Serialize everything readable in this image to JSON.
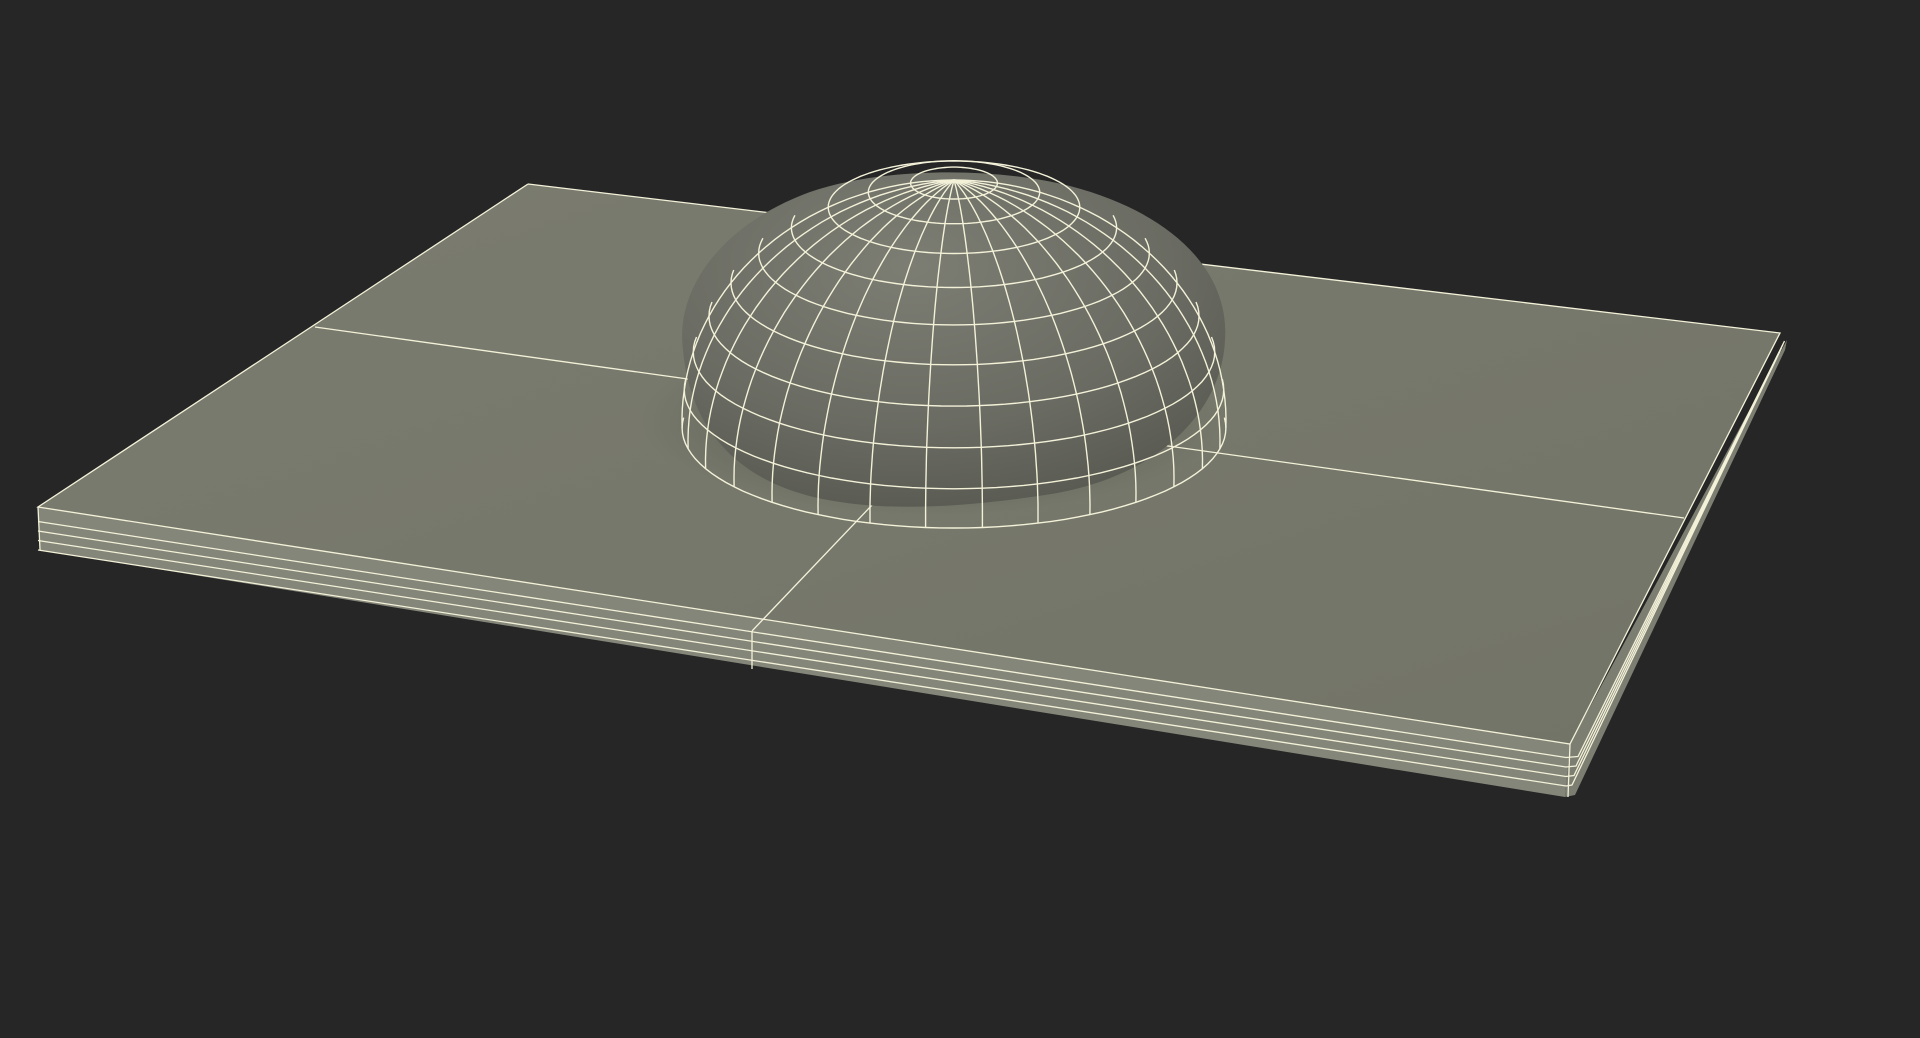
{
  "viewport": {
    "background_color": "#262626",
    "render_style": "shaded-wireframe"
  },
  "model": {
    "parts": [
      "tile-base",
      "dome-bump"
    ],
    "base": {
      "panel_rows": 2,
      "panel_columns": 2,
      "edge_bevel_loops": 4,
      "surface_color": "#787a6c",
      "edge_color": "#8a8b7d"
    },
    "dome": {
      "meridian_count": 30,
      "parallel_count": 10,
      "surface_color": "#6f7067"
    },
    "wireframe_color": "#f3f1d8"
  }
}
